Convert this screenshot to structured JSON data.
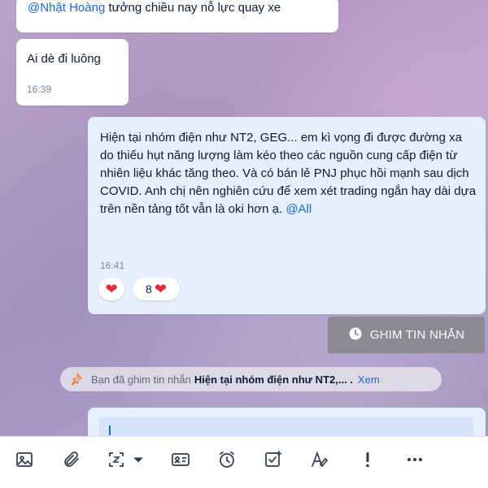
{
  "messages": [
    {
      "mention": "@Nhật Hoàng",
      "text": " tưởng chiều nay nỗ lực quay xe"
    },
    {
      "text": "Ai dè đi luông",
      "time": "16:39"
    },
    {
      "text": "Hiện tại nhóm điện như NT2, GEG... em kì vọng đi được đường xa do thiếu hụt năng lượng làm kéo theo các nguồn cung cấp điện từ nhiên liệu khác tăng theo. Và có bán lẻ PNJ phục hồi mạnh sau dịch COVID. Anh chị nên nghiên cứu để xem xét trading ngắn hay dài dựa trên nền tảng tốt vẫn là oki hơn ạ. ",
      "mention": "@All",
      "time": "16:41",
      "reactions": {
        "count": "8"
      }
    }
  ],
  "pin_button": {
    "label": "GHIM TIN NHẮN"
  },
  "pin_notice": {
    "prefix": "Bạn đã ghim tin nhắn",
    "message": "Hiện tại nhóm điện như NT2,... .",
    "link": "Xem"
  },
  "toolbar": {
    "icons": [
      "image-icon",
      "attachment-icon",
      "screenshot-icon",
      "dropdown-caret-icon",
      "contact-card-icon",
      "reminder-icon",
      "task-icon",
      "text-format-icon",
      "urgent-icon",
      "more-icon"
    ]
  },
  "colors": {
    "mention": "#1a66e0",
    "heart": "#e8273b",
    "my_bubble": "#e5efff",
    "pin_button": "#8c8994"
  }
}
